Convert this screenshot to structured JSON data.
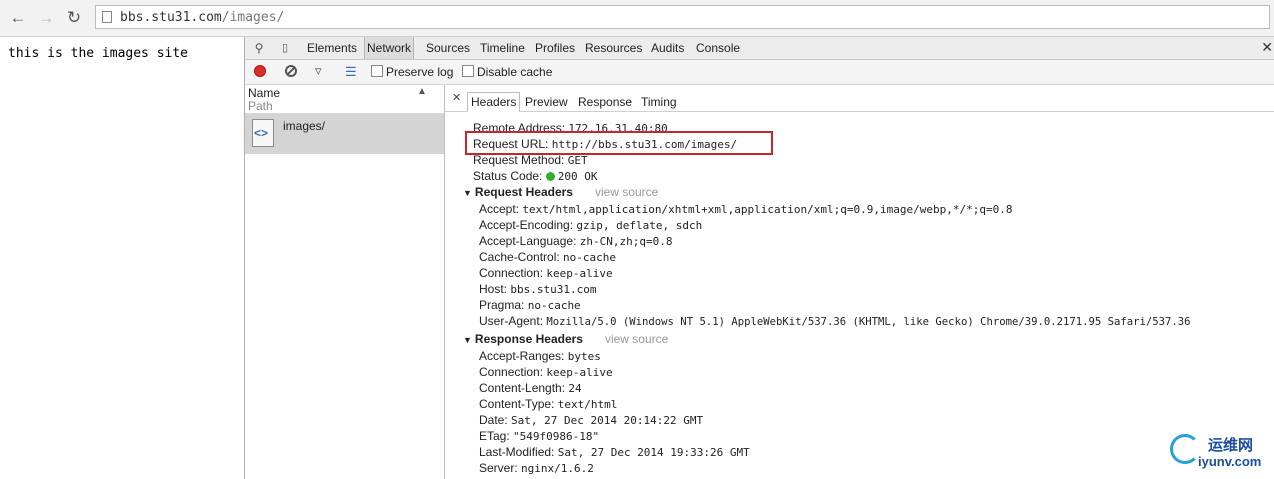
{
  "browser": {
    "back_icon": "arrow-left",
    "forward_icon": "arrow-right",
    "reload_icon": "reload",
    "url_host": "bbs.stu31.com",
    "url_path": "/images/"
  },
  "page": {
    "body_text": "this is the images site"
  },
  "devtools": {
    "tabs": [
      "Elements",
      "Network",
      "Sources",
      "Timeline",
      "Profiles",
      "Resources",
      "Audits",
      "Console"
    ],
    "active_tab": "Network",
    "toolbar": {
      "preserve_log": "Preserve log",
      "disable_cache": "Disable cache"
    },
    "list": {
      "col_name": "Name",
      "col_path": "Path",
      "requests": [
        {
          "name": "images/"
        }
      ]
    },
    "detail": {
      "tabs": [
        "Headers",
        "Preview",
        "Response",
        "Timing"
      ],
      "active_tab": "Headers",
      "general": [
        {
          "k": "Remote Address:",
          "v": "172.16.31.40:80"
        },
        {
          "k": "Request URL:",
          "v": "http://bbs.stu31.com/images/"
        },
        {
          "k": "Request Method:",
          "v": "GET"
        },
        {
          "k": "Status Code:",
          "v": "200 OK"
        }
      ],
      "request_headers": {
        "title": "Request Headers",
        "view_source": "view source",
        "items": [
          {
            "k": "Accept:",
            "v": "text/html,application/xhtml+xml,application/xml;q=0.9,image/webp,*/*;q=0.8"
          },
          {
            "k": "Accept-Encoding:",
            "v": "gzip, deflate, sdch"
          },
          {
            "k": "Accept-Language:",
            "v": "zh-CN,zh;q=0.8"
          },
          {
            "k": "Cache-Control:",
            "v": "no-cache"
          },
          {
            "k": "Connection:",
            "v": "keep-alive"
          },
          {
            "k": "Host:",
            "v": "bbs.stu31.com"
          },
          {
            "k": "Pragma:",
            "v": "no-cache"
          },
          {
            "k": "User-Agent:",
            "v": "Mozilla/5.0 (Windows NT 5.1) AppleWebKit/537.36 (KHTML, like Gecko) Chrome/39.0.2171.95 Safari/537.36"
          }
        ]
      },
      "response_headers": {
        "title": "Response Headers",
        "view_source": "view source",
        "items": [
          {
            "k": "Accept-Ranges:",
            "v": "bytes"
          },
          {
            "k": "Connection:",
            "v": "keep-alive"
          },
          {
            "k": "Content-Length:",
            "v": "24"
          },
          {
            "k": "Content-Type:",
            "v": "text/html"
          },
          {
            "k": "Date:",
            "v": "Sat, 27 Dec 2014 20:14:22 GMT"
          },
          {
            "k": "ETag:",
            "v": "\"549f0986-18\""
          },
          {
            "k": "Last-Modified:",
            "v": "Sat, 27 Dec 2014 19:33:26 GMT"
          },
          {
            "k": "Server:",
            "v": "nginx/1.6.2"
          }
        ]
      }
    }
  },
  "watermark": {
    "cn": "运维网",
    "en": "iyunv.com"
  },
  "colors": {
    "highlight_box": "#c9252c",
    "status_ok": "#2fb12f",
    "record": "#d9302c"
  }
}
